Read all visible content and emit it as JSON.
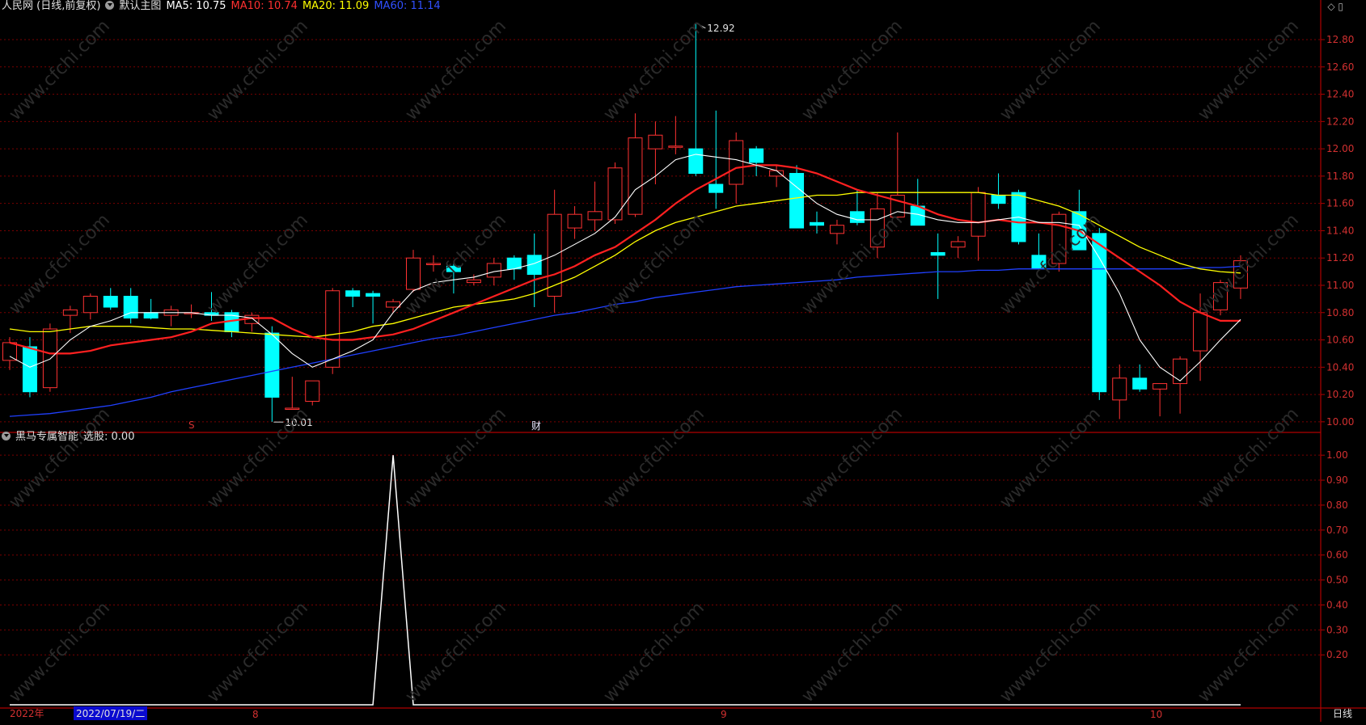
{
  "main_header": {
    "stock": "人民网 (日线,前复权)",
    "template": "默认主图",
    "ma5": "MA5: 10.75",
    "ma10": "MA10: 10.74",
    "ma20": "MA20: 11.09",
    "ma60": "MA60: 11.14"
  },
  "sub_header": {
    "indicator": "黑马专属智能",
    "value_text": "选股: 0.00"
  },
  "top_icons": [
    "◇",
    "▯"
  ],
  "bottom_axis": {
    "year": "2022年",
    "cursor_date": "2022/07/19/二",
    "month_8": "8",
    "month_9": "9",
    "month_10": "10",
    "period": "日线"
  },
  "markers": {
    "s": "S",
    "cai": "财"
  },
  "annotations": {
    "high": "12.92",
    "low": "10.01"
  },
  "colors": {
    "up": "#ff3232",
    "down": "#00ffff",
    "ma5": "#ffffff",
    "ma10": "#ff2020",
    "ma20": "#ffff00",
    "ma60": "#2040ff",
    "grid": "#7a0000",
    "axis_text": "#d23030"
  },
  "chart_data": [
    {
      "type": "candlestick",
      "yticks": [
        12.8,
        12.6,
        12.4,
        12.2,
        12.0,
        11.8,
        11.6,
        11.4,
        11.2,
        11.0,
        10.8,
        10.6,
        10.4,
        10.2,
        10.0
      ],
      "ylim": [
        9.94,
        12.96
      ],
      "candles": [
        [
          10.45,
          10.62,
          10.38,
          10.58
        ],
        [
          10.55,
          10.62,
          10.18,
          10.22
        ],
        [
          10.25,
          10.72,
          10.22,
          10.68
        ],
        [
          10.78,
          10.85,
          10.65,
          10.82
        ],
        [
          10.8,
          10.94,
          10.75,
          10.92
        ],
        [
          10.92,
          10.98,
          10.82,
          10.84
        ],
        [
          10.92,
          10.98,
          10.72,
          10.76
        ],
        [
          10.8,
          10.9,
          10.75,
          10.76
        ],
        [
          10.78,
          10.85,
          10.7,
          10.82
        ],
        [
          10.8,
          10.86,
          10.76,
          10.8
        ],
        [
          10.8,
          10.95,
          10.74,
          10.78
        ],
        [
          10.8,
          10.82,
          10.62,
          10.66
        ],
        [
          10.72,
          10.8,
          10.66,
          10.78
        ],
        [
          10.65,
          10.7,
          10.0,
          10.18
        ],
        [
          10.1,
          10.33,
          10.1,
          10.1
        ],
        [
          10.15,
          10.3,
          10.12,
          10.3
        ],
        [
          10.4,
          10.98,
          10.35,
          10.96
        ],
        [
          10.96,
          10.98,
          10.84,
          10.92
        ],
        [
          10.94,
          10.96,
          10.72,
          10.92
        ],
        [
          10.84,
          10.9,
          10.8,
          10.88
        ],
        [
          10.97,
          11.26,
          10.95,
          11.2
        ],
        [
          11.16,
          11.22,
          11.1,
          11.16
        ],
        [
          11.14,
          11.16,
          10.94,
          11.1
        ],
        [
          11.02,
          11.08,
          11.0,
          11.04
        ],
        [
          11.06,
          11.2,
          11.0,
          11.16
        ],
        [
          11.2,
          11.22,
          11.04,
          11.12
        ],
        [
          11.22,
          11.38,
          10.84,
          11.08
        ],
        [
          10.92,
          11.7,
          10.8,
          11.52
        ],
        [
          11.42,
          11.58,
          11.34,
          11.52
        ],
        [
          11.48,
          11.76,
          11.4,
          11.54
        ],
        [
          11.48,
          11.9,
          11.45,
          11.86
        ],
        [
          11.52,
          12.26,
          11.5,
          12.08
        ],
        [
          12.0,
          12.2,
          11.74,
          12.1
        ],
        [
          12.02,
          12.24,
          11.96,
          12.02
        ],
        [
          12.0,
          12.92,
          11.8,
          11.82
        ],
        [
          11.74,
          12.28,
          11.56,
          11.68
        ],
        [
          11.74,
          12.12,
          11.6,
          12.06
        ],
        [
          12.0,
          12.02,
          11.8,
          11.9
        ],
        [
          11.8,
          11.88,
          11.72,
          11.84
        ],
        [
          11.82,
          11.88,
          11.42,
          11.42
        ],
        [
          11.46,
          11.54,
          11.38,
          11.44
        ],
        [
          11.38,
          11.48,
          11.3,
          11.44
        ],
        [
          11.54,
          11.7,
          11.44,
          11.46
        ],
        [
          11.28,
          11.68,
          11.2,
          11.56
        ],
        [
          11.5,
          12.12,
          11.48,
          11.66
        ],
        [
          11.58,
          11.78,
          11.44,
          11.44
        ],
        [
          11.24,
          11.38,
          10.9,
          11.22
        ],
        [
          11.28,
          11.36,
          11.2,
          11.32
        ],
        [
          11.36,
          11.72,
          11.18,
          11.68
        ],
        [
          11.66,
          11.82,
          11.56,
          11.6
        ],
        [
          11.68,
          11.7,
          11.3,
          11.32
        ],
        [
          11.22,
          11.38,
          11.12,
          11.12
        ],
        [
          11.16,
          11.54,
          11.1,
          11.52
        ],
        [
          11.54,
          11.7,
          11.26,
          11.26
        ],
        [
          11.38,
          11.42,
          10.16,
          10.22
        ],
        [
          10.16,
          10.42,
          10.02,
          10.32
        ],
        [
          10.32,
          10.42,
          10.22,
          10.24
        ],
        [
          10.24,
          10.28,
          10.04,
          10.28
        ],
        [
          10.28,
          10.48,
          10.06,
          10.46
        ],
        [
          10.52,
          10.94,
          10.3,
          10.8
        ],
        [
          10.82,
          11.04,
          10.78,
          11.02
        ],
        [
          10.98,
          11.22,
          10.9,
          11.18
        ]
      ],
      "ma5": [
        10.48,
        10.4,
        10.46,
        10.6,
        10.7,
        10.74,
        10.8,
        10.8,
        10.8,
        10.8,
        10.78,
        10.78,
        10.76,
        10.64,
        10.5,
        10.4,
        10.46,
        10.52,
        10.6,
        10.8,
        10.96,
        11.02,
        11.04,
        11.06,
        11.1,
        11.12,
        11.16,
        11.22,
        11.3,
        11.38,
        11.5,
        11.7,
        11.8,
        11.92,
        11.96,
        11.94,
        11.92,
        11.88,
        11.84,
        11.72,
        11.6,
        11.52,
        11.48,
        11.48,
        11.54,
        11.52,
        11.48,
        11.46,
        11.46,
        11.48,
        11.5,
        11.46,
        11.46,
        11.44,
        11.2,
        10.94,
        10.6,
        10.4,
        10.3,
        10.44,
        10.6,
        10.75
      ],
      "ma10": [
        10.58,
        10.54,
        10.5,
        10.5,
        10.52,
        10.56,
        10.58,
        10.6,
        10.62,
        10.66,
        10.72,
        10.74,
        10.76,
        10.76,
        10.68,
        10.62,
        10.6,
        10.6,
        10.62,
        10.64,
        10.68,
        10.74,
        10.8,
        10.86,
        10.92,
        10.98,
        11.04,
        11.08,
        11.14,
        11.22,
        11.28,
        11.38,
        11.48,
        11.6,
        11.7,
        11.78,
        11.86,
        11.88,
        11.88,
        11.86,
        11.82,
        11.76,
        11.7,
        11.66,
        11.62,
        11.58,
        11.52,
        11.48,
        11.46,
        11.48,
        11.46,
        11.46,
        11.44,
        11.4,
        11.3,
        11.2,
        11.1,
        11.0,
        10.88,
        10.8,
        10.74,
        10.74
      ],
      "ma20": [
        10.68,
        10.66,
        10.66,
        10.68,
        10.7,
        10.7,
        10.7,
        10.69,
        10.68,
        10.68,
        10.67,
        10.66,
        10.65,
        10.64,
        10.63,
        10.62,
        10.64,
        10.66,
        10.7,
        10.72,
        10.76,
        10.8,
        10.84,
        10.86,
        10.88,
        10.9,
        10.94,
        11.0,
        11.06,
        11.14,
        11.22,
        11.32,
        11.4,
        11.46,
        11.5,
        11.54,
        11.58,
        11.6,
        11.62,
        11.64,
        11.66,
        11.66,
        11.68,
        11.68,
        11.68,
        11.68,
        11.68,
        11.68,
        11.68,
        11.66,
        11.66,
        11.62,
        11.58,
        11.52,
        11.44,
        11.36,
        11.28,
        11.22,
        11.16,
        11.12,
        11.1,
        11.09
      ],
      "ma60": [
        10.04,
        10.05,
        10.06,
        10.08,
        10.1,
        10.12,
        10.15,
        10.18,
        10.22,
        10.25,
        10.28,
        10.31,
        10.34,
        10.37,
        10.4,
        10.43,
        10.46,
        10.49,
        10.52,
        10.55,
        10.58,
        10.61,
        10.63,
        10.66,
        10.69,
        10.72,
        10.75,
        10.78,
        10.8,
        10.83,
        10.86,
        10.88,
        10.91,
        10.93,
        10.95,
        10.97,
        10.99,
        11.0,
        11.01,
        11.02,
        11.03,
        11.04,
        11.06,
        11.07,
        11.08,
        11.09,
        11.1,
        11.1,
        11.11,
        11.11,
        11.12,
        11.12,
        11.12,
        11.12,
        11.12,
        11.12,
        11.12,
        11.12,
        11.12,
        11.13,
        11.13,
        11.14
      ]
    },
    {
      "type": "line",
      "name": "选股",
      "yticks": [
        1.0,
        0.9,
        0.8,
        0.7,
        0.6,
        0.5,
        0.4,
        0.3,
        0.2
      ],
      "ylim": [
        0.0,
        1.02
      ],
      "values_by_bar": {
        "default": 0.0,
        "19": 1.0
      }
    }
  ]
}
